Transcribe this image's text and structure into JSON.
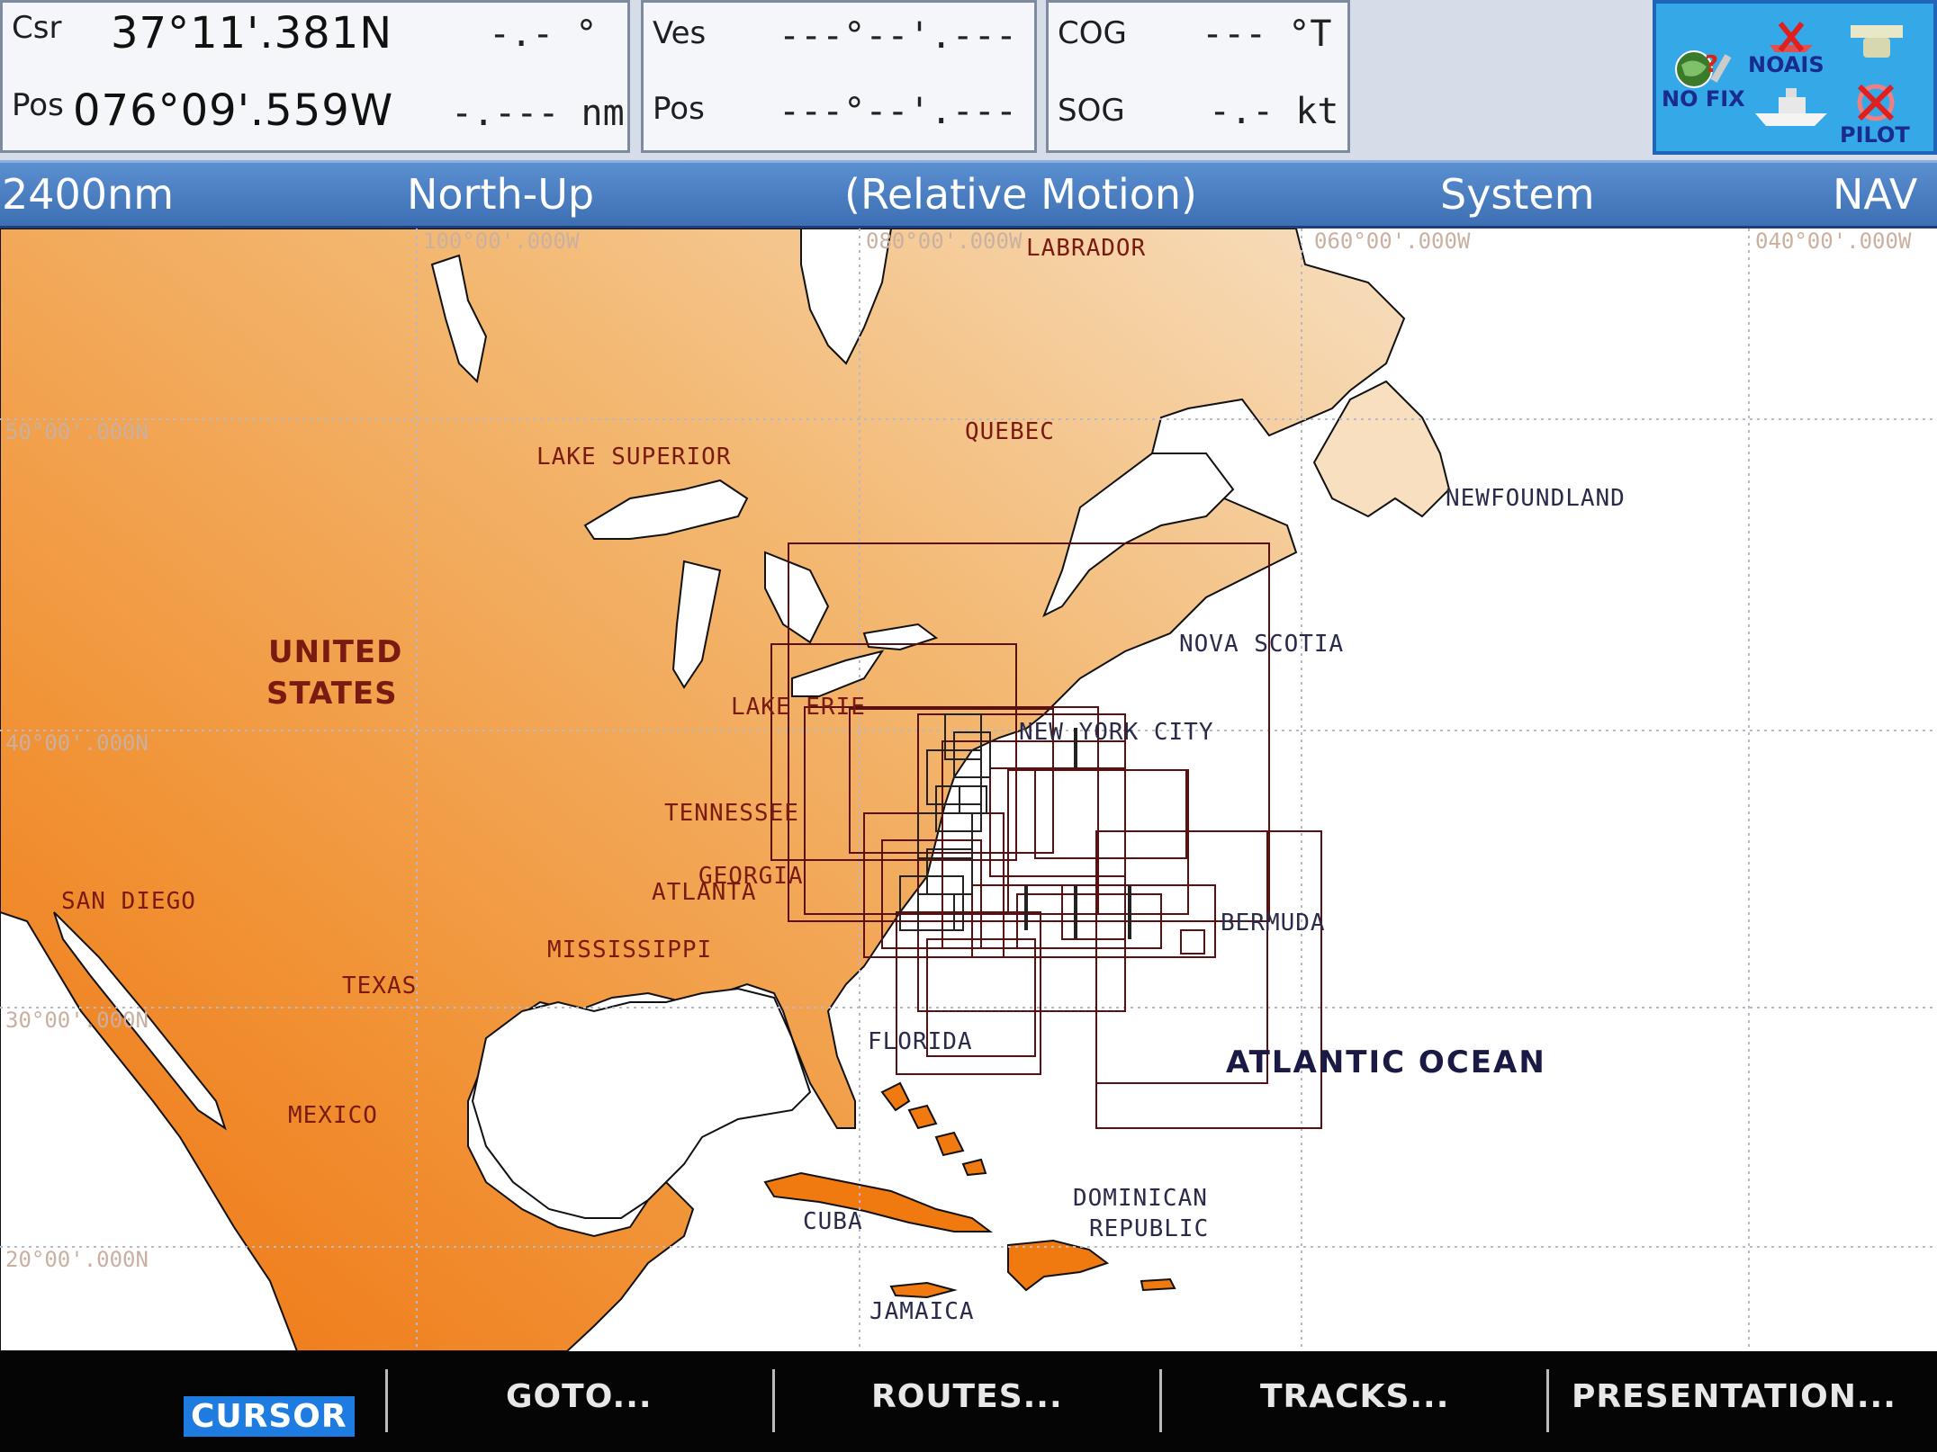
{
  "cursor": {
    "label": "Csr",
    "pos_label": "Pos",
    "lat": "37°11'.381N",
    "lon": "076°09'.559W",
    "bearing": "-.- °",
    "range": "-.--- nm"
  },
  "vessel": {
    "label": "Ves",
    "pos_label": "Pos",
    "lat": "---°--'.---",
    "lon": "---°--'.---"
  },
  "course": {
    "cog_label": "COG",
    "cog_value": "--- °T",
    "sog_label": "SOG",
    "sog_value": "-.- kt"
  },
  "status": {
    "gps": "NO FIX",
    "ais": "NOAIS",
    "pilot": "PILOT"
  },
  "mode_bar": {
    "range": "2400nm",
    "orientation": "North-Up",
    "motion": "(Relative Motion)",
    "menu": "System",
    "mode": "NAV"
  },
  "grid": {
    "lon_labels": [
      "100°00'.000W",
      "080°00'.000W",
      "060°00'.000W",
      "040°00'.000W"
    ],
    "lat_labels": [
      "50°00'.000N",
      "40°00'.000N",
      "30°00'.000N",
      "20°00'.000N"
    ]
  },
  "map_labels": {
    "labrador": "LABRADOR",
    "quebec": "QUEBEC",
    "lake_superior": "LAKE SUPERIOR",
    "newfoundland": "NEWFOUNDLAND",
    "united": "UNITED",
    "states": "STATES",
    "nova_scotia": "NOVA SCOTIA",
    "lake_erie": "LAKE ERIE",
    "new_york_city": "NEW YORK CITY",
    "tennessee": "TENNESSEE",
    "georgia": "GEORGIA",
    "atlanta": "ATLANTA",
    "san_diego": "SAN DIEGO",
    "bermuda": "BERMUDA",
    "mississippi": "MISSISSIPPI",
    "texas": "TEXAS",
    "florida": "FLORIDA",
    "atlantic_ocean": "ATLANTIC OCEAN",
    "mexico": "MEXICO",
    "dominican": "DOMINICAN",
    "republic": "REPUBLIC",
    "cuba": "CUBA",
    "jamaica": "JAMAICA"
  },
  "softkeys": {
    "cursor": "CURSOR",
    "goto": "GOTO...",
    "routes": "ROUTES...",
    "tracks": "TRACKS...",
    "presentation": "PRESENTATION..."
  },
  "colors": {
    "land_light": "#f2c48a",
    "land_dark": "#f07a10",
    "water": "#ffffff",
    "chart_outline": "#7a1a10",
    "mode_bar": "#4a7dc0"
  }
}
